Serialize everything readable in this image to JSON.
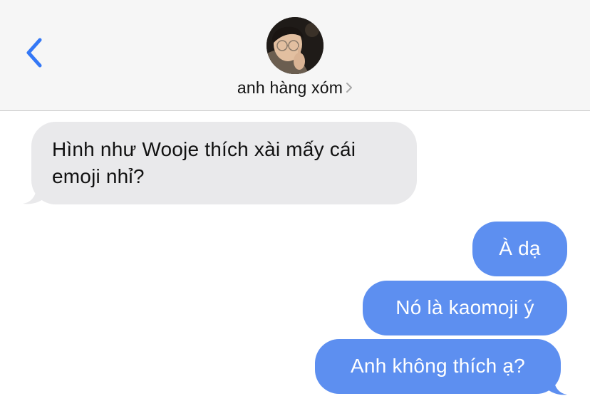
{
  "header": {
    "back_icon": "chevron-left-icon",
    "contact_name": "anh hàng xóm",
    "accent_color": "#3478f6"
  },
  "messages": [
    {
      "direction": "incoming",
      "text_line1": "Hình như Wooje thích xài mấy cái",
      "text_line2": "emoji nhỉ?"
    },
    {
      "direction": "outgoing",
      "text": "À dạ"
    },
    {
      "direction": "outgoing",
      "text": "Nó là kaomoji ý"
    },
    {
      "direction": "outgoing",
      "text": "Anh không thích ạ?"
    }
  ],
  "colors": {
    "incoming_bubble": "#e9e9eb",
    "outgoing_bubble": "#5d8ff0",
    "header_bg": "#f6f6f6"
  }
}
